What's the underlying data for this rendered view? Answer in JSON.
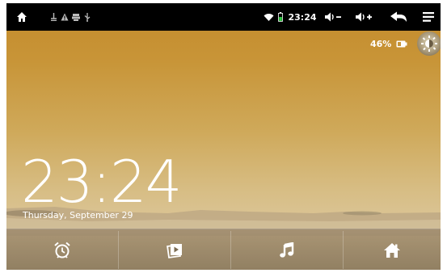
{
  "statusbar": {
    "left_icons": [
      "home-icon",
      "usb-debug-icon",
      "warning-icon",
      "download-icon",
      "usb-icon"
    ],
    "clock": "23:24",
    "right_icons": [
      "wifi-icon",
      "battery-small-icon",
      "volume-down-icon",
      "volume-up-icon",
      "back-icon",
      "menu-icon"
    ]
  },
  "battery": {
    "percent": "46%"
  },
  "lockscreen": {
    "time": "23:24",
    "date": "Thursday, September 29"
  },
  "dock": {
    "items": [
      {
        "icon": "alarm-clock-icon"
      },
      {
        "icon": "gallery-icon"
      },
      {
        "icon": "music-icon"
      },
      {
        "icon": "home-icon"
      }
    ]
  },
  "colors": {
    "sky_top": "#c48a2a",
    "sky_bottom": "#dcc79c",
    "statusbar": "#000000",
    "battery_green": "#2ecc40"
  }
}
